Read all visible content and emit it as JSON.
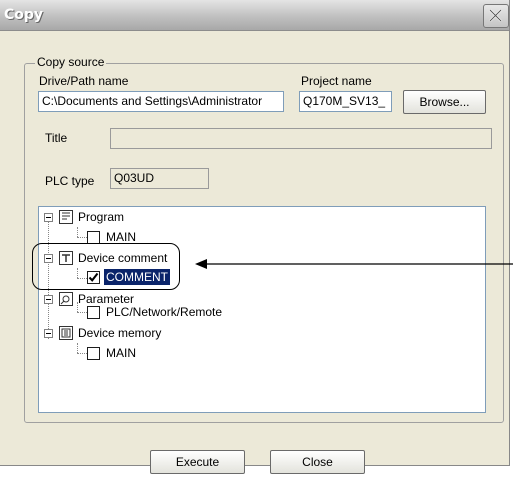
{
  "window": {
    "title": "Copy"
  },
  "copy_source": {
    "legend": "Copy source",
    "drive_path_label": "Drive/Path name",
    "drive_path_value": "C:\\Documents and Settings\\Administrator",
    "project_name_label": "Project name",
    "project_name_value": "Q170M_SV13_",
    "browse_label": "Browse...",
    "title_label": "Title",
    "title_value": "",
    "plc_type_label": "PLC type",
    "plc_type_value": "Q03UD"
  },
  "tree": {
    "items": [
      {
        "label": "Program",
        "icon": "program-icon"
      },
      {
        "label": "MAIN",
        "checked": false
      },
      {
        "label": "Device comment",
        "icon": "device-comment-icon"
      },
      {
        "label": "COMMENT",
        "checked": true
      },
      {
        "label": "Parameter",
        "icon": "parameter-icon"
      },
      {
        "label": "PLC/Network/Remote",
        "checked": false
      },
      {
        "label": "Device memory",
        "icon": "device-memory-icon"
      },
      {
        "label": "MAIN",
        "checked": false
      }
    ]
  },
  "buttons": {
    "execute": "Execute",
    "close": "Close"
  },
  "annotation": {
    "arrow_color": "#000000"
  }
}
